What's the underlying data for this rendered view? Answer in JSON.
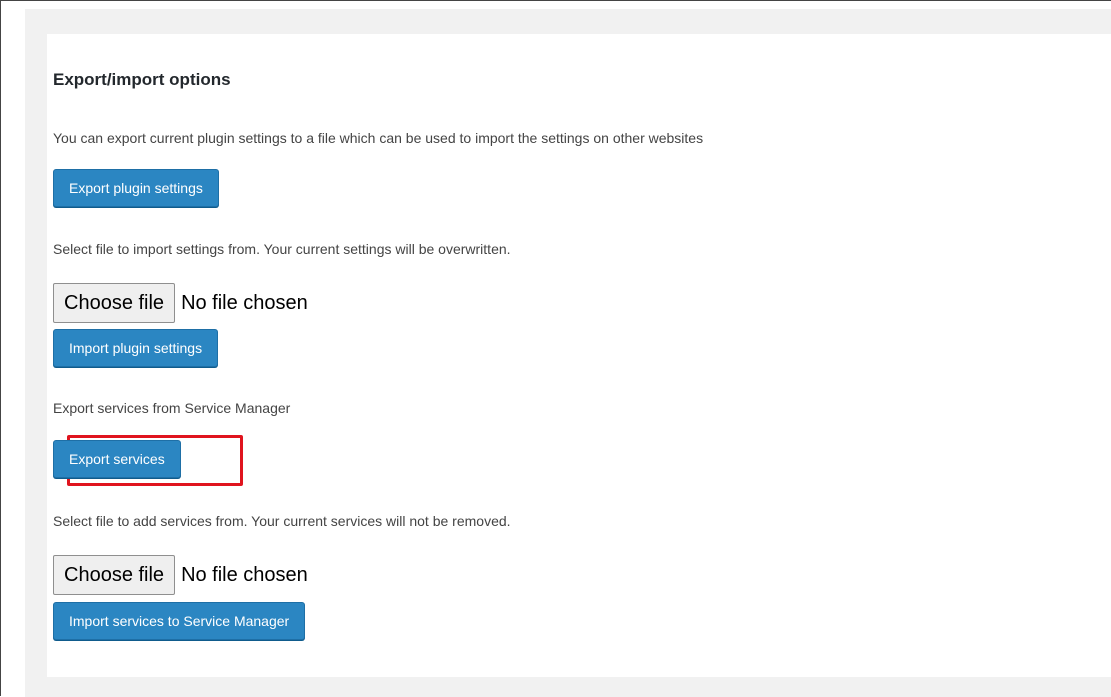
{
  "section": {
    "title": "Export/import options"
  },
  "export_settings": {
    "description": "You can export current plugin settings to a file which can be used to import the settings on other websites",
    "button_label": "Export plugin settings"
  },
  "import_settings": {
    "description": "Select file to import settings from. Your current settings will be overwritten.",
    "file_button_label": "Choose file",
    "file_status": "No file chosen",
    "button_label": "Import plugin settings"
  },
  "export_services": {
    "description": "Export services from Service Manager",
    "button_label": "Export services",
    "highlight_color": "#e0141e"
  },
  "import_services": {
    "description": "Select file to add services from. Your current services will not be removed.",
    "file_button_label": "Choose file",
    "file_status": "No file chosen",
    "button_label": "Import services to Service Manager"
  },
  "colors": {
    "primary_button": "#2b86c2",
    "page_background": "#f1f1f1",
    "panel_background": "#ffffff"
  }
}
